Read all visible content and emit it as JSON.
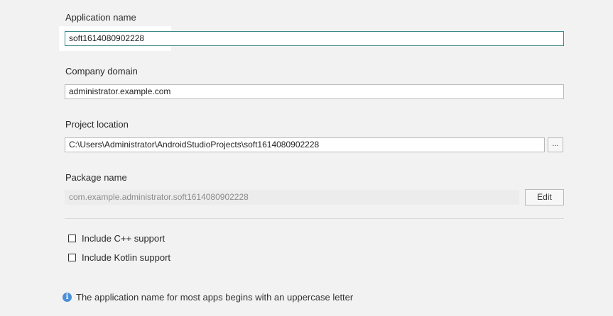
{
  "form": {
    "application_name": {
      "label": "Application name",
      "value": "soft1614080902228"
    },
    "company_domain": {
      "label": "Company domain",
      "value": "administrator.example.com"
    },
    "project_location": {
      "label": "Project location",
      "value": "C:\\Users\\Administrator\\AndroidStudioProjects\\soft1614080902228",
      "browse_label": "..."
    },
    "package_name": {
      "label": "Package name",
      "value": "com.example.administrator.soft1614080902228",
      "edit_label": "Edit"
    },
    "options": [
      {
        "label": "Include C++ support",
        "checked": false
      },
      {
        "label": "Include Kotlin support",
        "checked": false
      }
    ]
  },
  "hint": {
    "icon": "info-icon",
    "text": "The application name for most apps begins with an uppercase letter"
  },
  "colors": {
    "background": "#f2f2f2",
    "focus_border": "#3c8a8a",
    "info_blue": "#4a90d9"
  }
}
